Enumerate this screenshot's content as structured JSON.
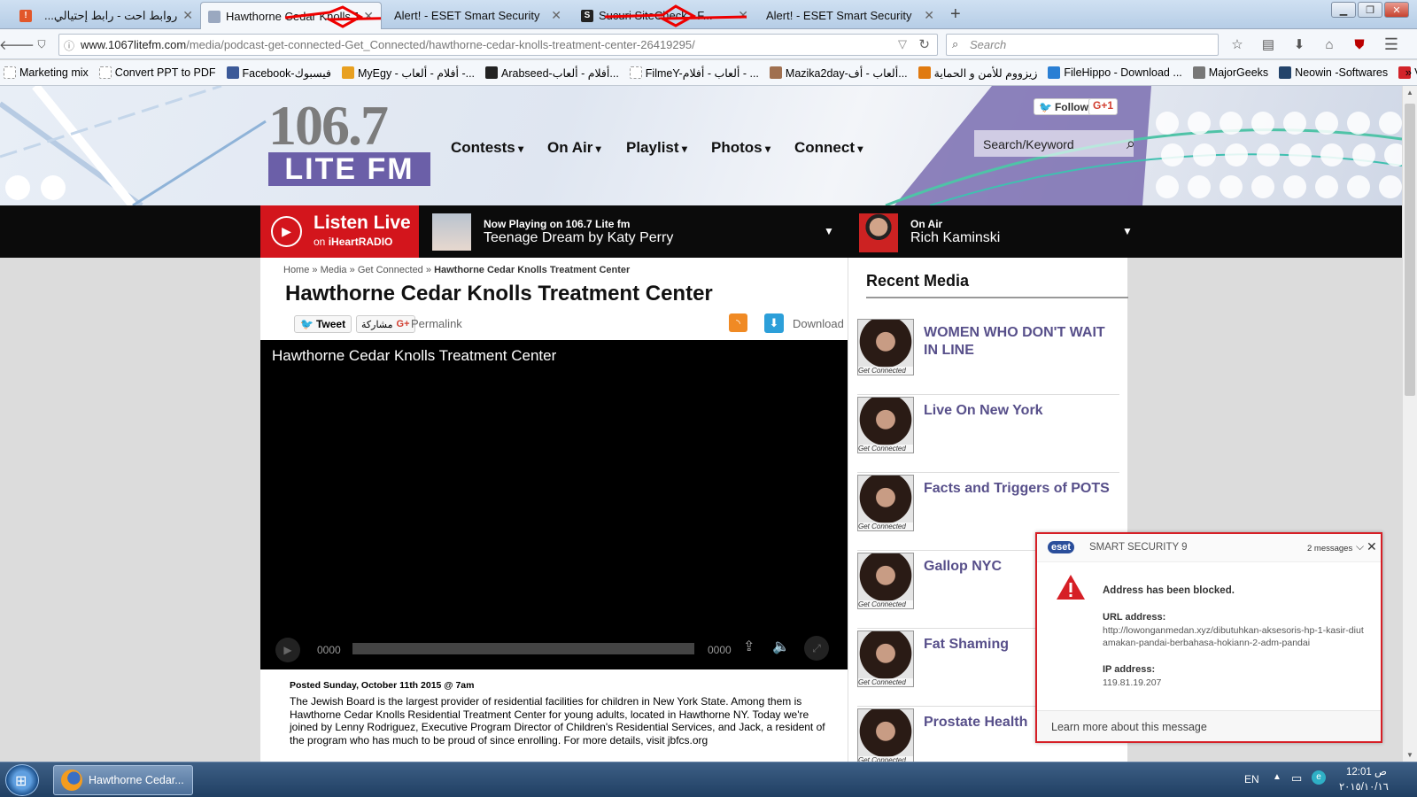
{
  "browser": {
    "tabs": [
      {
        "title": "روابط احت - رابط إحتيالي...",
        "active": false
      },
      {
        "title": "Hawthorne Cedar Knolls Tr...",
        "active": true
      },
      {
        "title": "Alert! - ESET Smart Security",
        "active": false
      },
      {
        "title": "Sucuri SiteCheck - F...",
        "active": false
      },
      {
        "title": "Alert! - ESET Smart Security",
        "active": false
      }
    ],
    "url_domain": "www.1067litefm.com",
    "url_path": "/media/podcast-get-connected-Get_Connected/hawthorne-cedar-knolls-treatment-center-26419295/",
    "search_placeholder": "Search",
    "bookmarks": [
      {
        "label": "Marketing mix",
        "icon": "page-icon",
        "color": "#cccccc"
      },
      {
        "label": "Convert PPT to PDF",
        "icon": "page-icon",
        "color": "#cccccc"
      },
      {
        "label": "Facebook-فيسبوك",
        "icon": "facebook-icon",
        "color": "#3b5998"
      },
      {
        "label": "MyEgy - أفلام - ألعاب -...",
        "icon": "myegy-icon",
        "color": "#e8a020"
      },
      {
        "label": "Arabseed-أفلام - ألعاب...",
        "icon": "arabseed-icon",
        "color": "#222222"
      },
      {
        "label": "FilmeY-ألعاب - أفلام - ...",
        "icon": "page-icon",
        "color": "#cccccc"
      },
      {
        "label": "Mazika2day-ألعاب - أف...",
        "icon": "mazika-icon",
        "color": "#a07050"
      },
      {
        "label": "زيزووم للأمن و الحماية",
        "icon": "zizoom-icon",
        "color": "#e07a10"
      },
      {
        "label": "FileHippo - Download ...",
        "icon": "filehippo-icon",
        "color": "#2a7fd4"
      },
      {
        "label": "MajorGeeks",
        "icon": "majorgeeks-icon",
        "color": "#777777"
      },
      {
        "label": "Neowin -Softwares",
        "icon": "neowin-icon",
        "color": "#23446b"
      },
      {
        "label": "Vivaldi Browser",
        "icon": "vivaldi-icon",
        "color": "#d2232a"
      }
    ]
  },
  "site": {
    "logo_number": "106.7",
    "logo_text": "LITE FM",
    "social_follow": "Follow",
    "social_gplus": "G+1",
    "nav": [
      "Contests",
      "On Air",
      "Playlist",
      "Photos",
      "Connect"
    ],
    "search_placeholder": "Search/Keyword",
    "listen_live": "Listen Live",
    "listen_on": "on",
    "iheart": "iHeartRADIO",
    "now_playing_label": "Now Playing on 106.7 Lite fm",
    "now_playing_song": "Teenage Dream by Katy Perry",
    "on_air_label": "On Air",
    "on_air_host": "Rich Kaminski"
  },
  "article": {
    "breadcrumb": [
      "Home",
      "Media",
      "Get Connected",
      "Hawthorne Cedar Knolls Treatment Center"
    ],
    "breadcrumb_sep": "»",
    "title": "Hawthorne Cedar Knolls Treatment Center",
    "tweet": "Tweet",
    "share": "مشاركة",
    "share_gplus": "G+",
    "permalink": "Permalink",
    "download": "Download",
    "video_title": "Hawthorne Cedar Knolls Treatment Center",
    "time_current": "0000",
    "time_total": "0000",
    "posted_label": "Posted",
    "posted_date": "Sunday, October 11th 2015 @ 7am",
    "body": "The Jewish Board is the largest provider of residential facilities for children in New York State. Among them is Hawthorne Cedar Knolls Residential Treatment Center for young adults, located in Hawthorne NY. Today we're joined by Lenny Rodriguez, Executive Program Director of Children's Residential Services, and Jack, a resident of the program who has much to be proud of since enrolling. For more details, visit jbfcs.org"
  },
  "sidebar": {
    "title": "Recent Media",
    "thumb_caption": "Get Connected",
    "items": [
      "WOMEN WHO DON'T WAIT IN LINE",
      "Live On New York",
      "Facts and Triggers of POTS",
      "Gallop NYC",
      "Fat Shaming",
      "Prostate Health"
    ]
  },
  "eset": {
    "brand": "eset",
    "product": "SMART SECURITY 9",
    "messages": "2 messages",
    "headline": "Address has been blocked.",
    "url_label": "URL address:",
    "url_value": "http://lowonganmedan.xyz/dibutuhkan-aksesoris-hp-1-kasir-diutamakan-pandai-berbahasa-hokiann-2-adm-pandai",
    "ip_label": "IP address:",
    "ip_value": "119.81.19.207",
    "learn_more": "Learn more about this message"
  },
  "taskbar": {
    "window_title": "Hawthorne Cedar...",
    "language": "EN",
    "time": "12:01 ص",
    "date": "٢٠١٥/١٠/١٦"
  },
  "colors": {
    "accent_red": "#d3151c",
    "media_link": "#574f8a",
    "eset_border": "#d61f26"
  }
}
